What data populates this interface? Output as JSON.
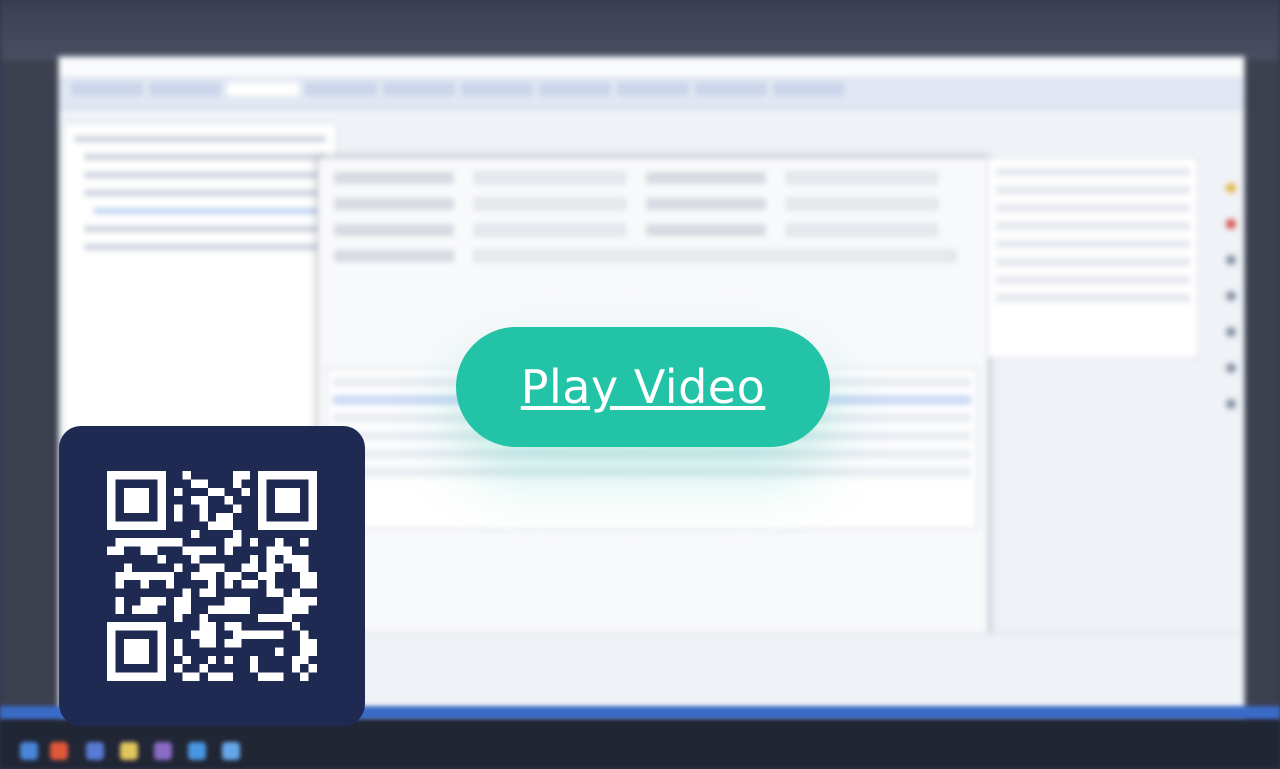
{
  "play_button": {
    "label": "Play Video"
  },
  "qr_code": {
    "icon": "qr-code-icon",
    "background": "#1f2a52",
    "foreground": "#ffffff"
  },
  "colors": {
    "accent": "#22c3a6",
    "page_bg": "#1b2344"
  }
}
